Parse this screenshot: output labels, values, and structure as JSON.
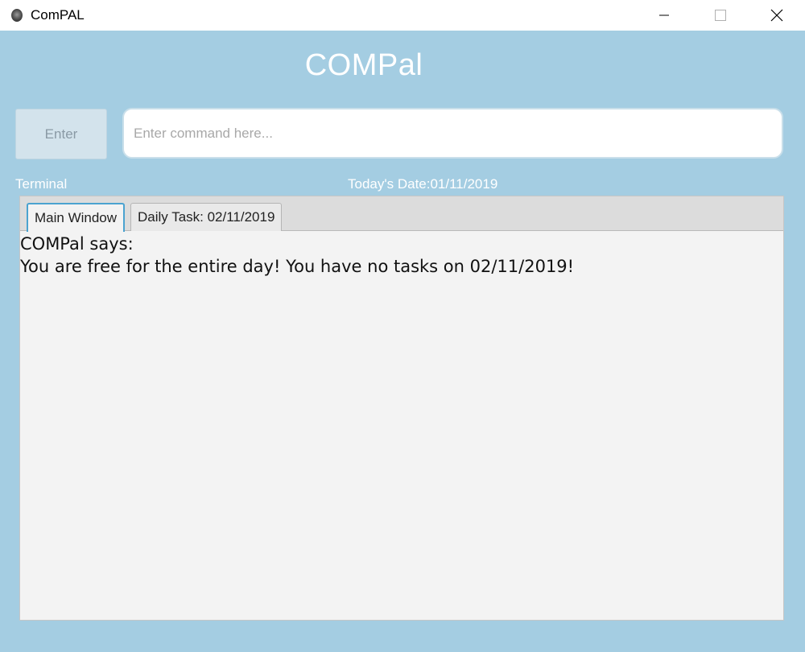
{
  "window": {
    "title": "ComPAL",
    "icon": "app-icon",
    "controls": [
      "minimize-icon",
      "maximize-icon",
      "close-icon"
    ]
  },
  "header": {
    "title": "COMPal"
  },
  "command": {
    "enter_label": "Enter",
    "input_value": "",
    "input_placeholder": "Enter command here..."
  },
  "labels": {
    "terminal": "Terminal",
    "date": "Today's Date:01/11/2019"
  },
  "tabs": [
    {
      "label": "Main Window",
      "active": true
    },
    {
      "label": "Daily Task: 02/11/2019",
      "active": false
    }
  ],
  "output": {
    "line1": "COMPal says:",
    "line2": "You are free for the entire day! You have no tasks on 02/11/2019!"
  },
  "colors": {
    "background": "#a4cde2",
    "active_tab_border": "#4ba3d0",
    "pane_background": "#f3f3f3"
  }
}
